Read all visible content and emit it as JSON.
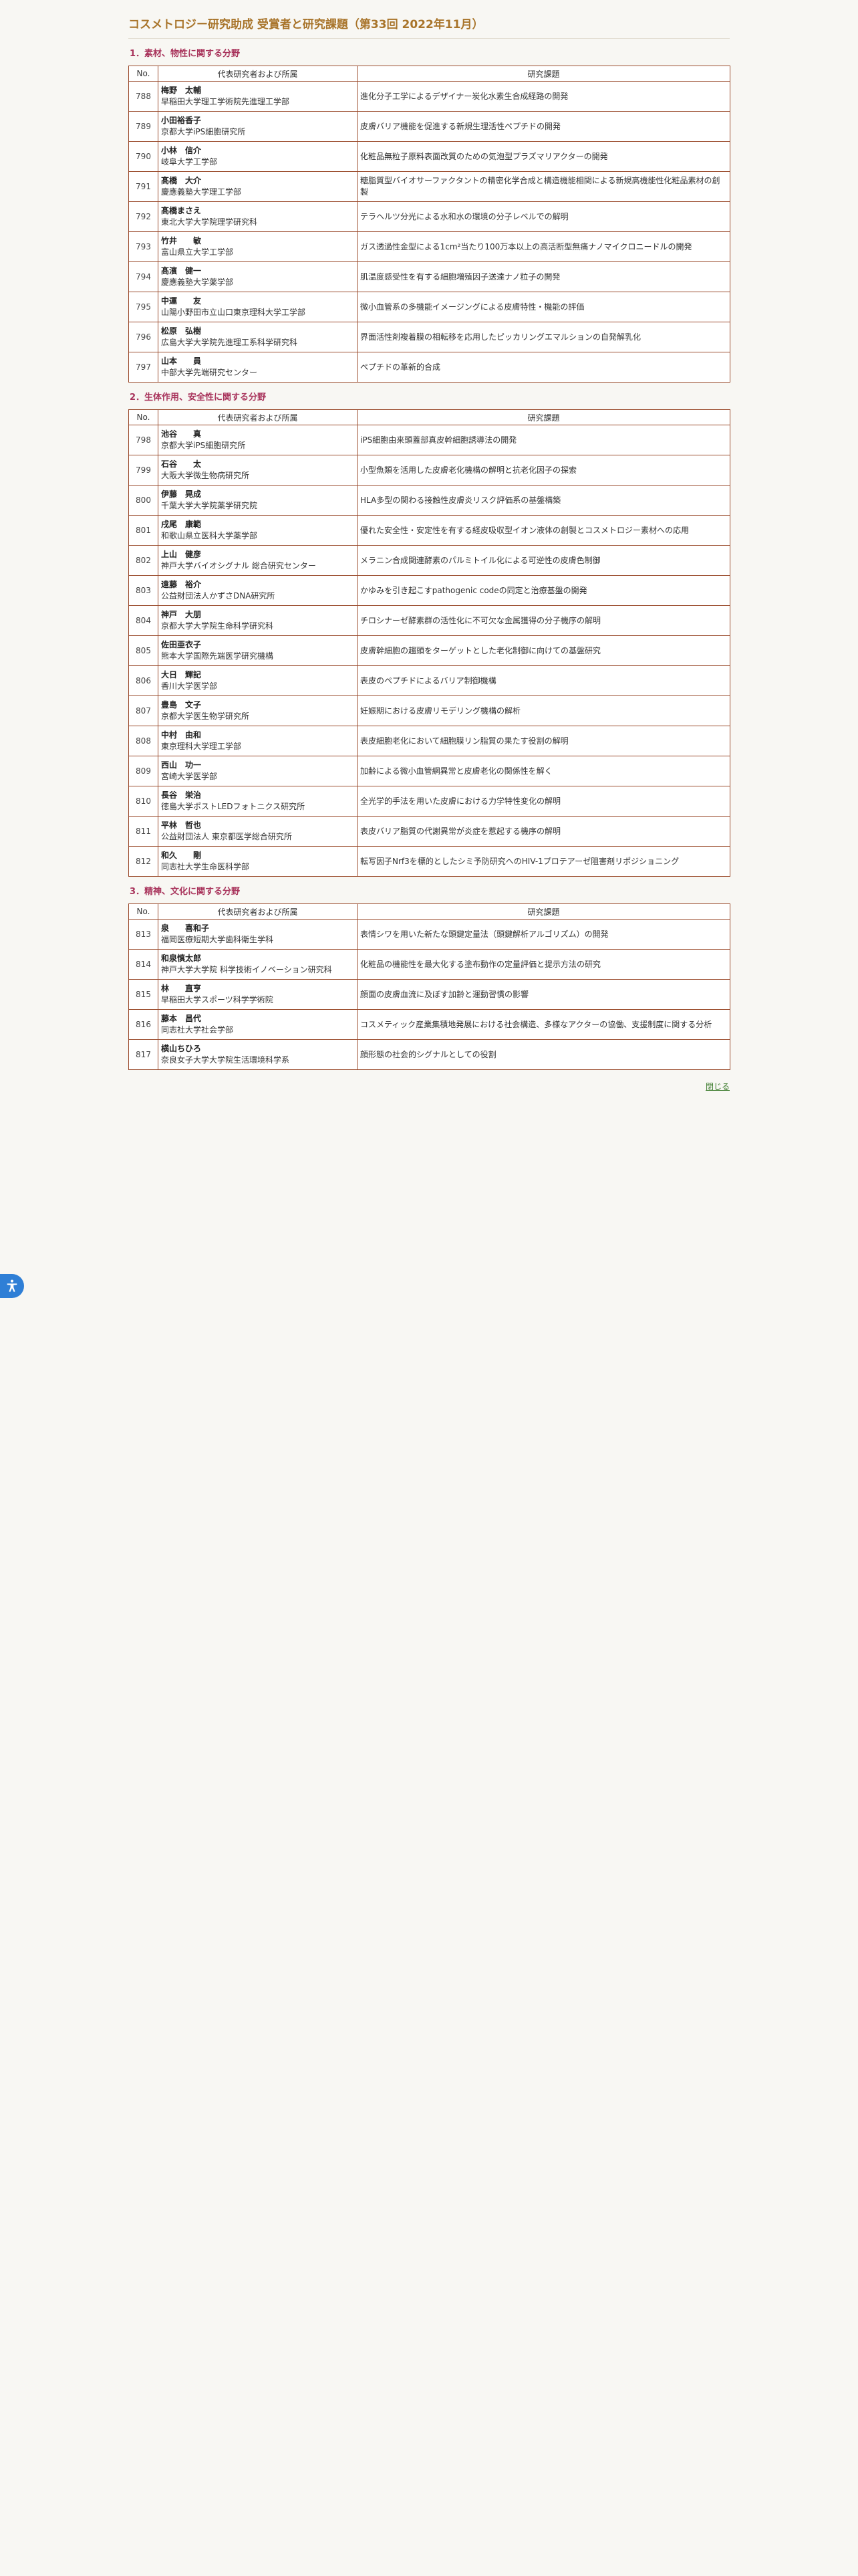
{
  "page_title": "コスメトロジー研究助成 受賞者と研究課題（第33回 2022年11月）",
  "table_headers": {
    "no": "No.",
    "person": "代表研究者および所属",
    "topic": "研究課題"
  },
  "close_label": "閉じる",
  "sections": [
    {
      "title": "1．素材、物性に関する分野",
      "rows": [
        {
          "no": "788",
          "name": "梅野　太輔",
          "aff": "早稲田大学理工学術院先進理工学部",
          "topic": "進化分子工学によるデザイナー炭化水素生合成経路の開発"
        },
        {
          "no": "789",
          "name": "小田裕香子",
          "aff": "京都大学iPS細胞研究所",
          "topic": "皮膚バリア機能を促進する新規生理活性ペプチドの開発"
        },
        {
          "no": "790",
          "name": "小林　信介",
          "aff": "岐阜大学工学部",
          "topic": "化粧品無粒子原料表面改質のための気泡型プラズマリアクターの開発"
        },
        {
          "no": "791",
          "name": "髙橋　大介",
          "aff": "慶應義塾大学理工学部",
          "topic": "糖脂質型バイオサーファクタントの精密化学合成と構造機能相関による新規高機能性化粧品素材の創製"
        },
        {
          "no": "792",
          "name": "髙橋まさえ",
          "aff": "東北大学大学院理学研究科",
          "topic": "テラヘルツ分光による水和水の環境の分子レベルでの解明"
        },
        {
          "no": "793",
          "name": "竹井　　敏",
          "aff": "富山県立大学工学部",
          "topic": "ガス透過性金型による1cm²当たり100万本以上の高活断型無痛ナノマイクロニードルの開発"
        },
        {
          "no": "794",
          "name": "髙濱　健一",
          "aff": "慶應義塾大学薬学部",
          "topic": "肌温度感受性を有する細胞増殖因子送達ナノ粒子の開発"
        },
        {
          "no": "795",
          "name": "中運　　友",
          "aff": "山陽小野田市立山口東京理科大学工学部",
          "topic": "微小血管系の多機能イメージングによる皮膚特性・機能の評価"
        },
        {
          "no": "796",
          "name": "松原　弘樹",
          "aff": "広島大学大学院先進理工系科学研究科",
          "topic": "界面活性剤複着膜の相転移を応用したピッカリングエマルションの自発解乳化"
        },
        {
          "no": "797",
          "name": "山本　　員",
          "aff": "中部大学先端研究センター",
          "topic": "ペプチドの革新的合成"
        }
      ]
    },
    {
      "title": "2．生体作用、安全性に関する分野",
      "rows": [
        {
          "no": "798",
          "name": "池谷　　真",
          "aff": "京都大学iPS細胞研究所",
          "topic": "iPS細胞由来頭蓋部真皮幹細胞誘導法の開発"
        },
        {
          "no": "799",
          "name": "石谷　　太",
          "aff": "大阪大学微生物病研究所",
          "topic": "小型魚類を活用した皮膚老化機構の解明と抗老化因子の探索"
        },
        {
          "no": "800",
          "name": "伊藤　晃成",
          "aff": "千葉大学大学院薬学研究院",
          "topic": "HLA多型の関わる接触性皮膚炎リスク評価系の基盤構築"
        },
        {
          "no": "801",
          "name": "戌尾　康範",
          "aff": "和歌山県立医科大学薬学部",
          "topic": "優れた安全性・安定性を有する経皮吸収型イオン液体の創製とコスメトロジー素材への応用"
        },
        {
          "no": "802",
          "name": "上山　健彦",
          "aff": "神戸大学バイオシグナル 総合研究センター",
          "topic": "メラニン合成関連酵素のパルミトイル化による可逆性の皮膚色制御"
        },
        {
          "no": "803",
          "name": "遠藤　裕介",
          "aff": "公益財団法人かずさDNA研究所",
          "topic": "かゆみを引き起こすpathogenic codeの同定と治療基盤の開発"
        },
        {
          "no": "804",
          "name": "神戸　大朋",
          "aff": "京都大学大学院生命科学研究科",
          "topic": "チロシナーゼ酵素群の活性化に不可欠な金属獲得の分子機序の解明"
        },
        {
          "no": "805",
          "name": "佐田亜衣子",
          "aff": "熊本大学国際先端医学研究機構",
          "topic": "皮膚幹細胞の趨頭をターゲットとした老化制御に向けての基盤研究"
        },
        {
          "no": "806",
          "name": "大日　輝記",
          "aff": "香川大学医学部",
          "topic": "表皮のペプチドによるバリア制御機構"
        },
        {
          "no": "807",
          "name": "豊島　文子",
          "aff": "京都大学医生物学研究所",
          "topic": "妊娠期における皮膚リモデリング機構の解析"
        },
        {
          "no": "808",
          "name": "中村　由和",
          "aff": "東京理科大学理工学部",
          "topic": "表皮細胞老化において細胞膜リン脂質の果たす役割の解明"
        },
        {
          "no": "809",
          "name": "西山　功一",
          "aff": "宮崎大学医学部",
          "topic": "加齢による微小血管網異常と皮膚老化の関係性を解く"
        },
        {
          "no": "810",
          "name": "長谷　栄治",
          "aff": "徳島大学ポストLEDフォトニクス研究所",
          "topic": "全光学的手法を用いた皮膚における力学特性変化の解明"
        },
        {
          "no": "811",
          "name": "平林　哲也",
          "aff": "公益財団法人 東京都医学総合研究所",
          "topic": "表皮バリア脂質の代謝異常が炎症を惹起する機序の解明"
        },
        {
          "no": "812",
          "name": "和久　　剛",
          "aff": "同志社大学生命医科学部",
          "topic": "転写因子Nrf3を標的としたシミ予防研究へのHIV-1プロテアーゼ阻害剤リポジショニング"
        }
      ]
    },
    {
      "title": "3．精神、文化に関する分野",
      "rows": [
        {
          "no": "813",
          "name": "泉　　喜和子",
          "aff": "福岡医療短期大学歯科衛生学科",
          "topic": "表情シワを用いた新たな頭鍵定量法（頭鍵解析アルゴリズム）の開発"
        },
        {
          "no": "814",
          "name": "和泉慎太郎",
          "aff": "神戸大学大学院 科学技術イノベーション研究科",
          "topic": "化粧品の機能性を最大化する塗布動作の定量評価と提示方法の研究"
        },
        {
          "no": "815",
          "name": "林　　直亨",
          "aff": "早稲田大学スポーツ科学学術院",
          "topic": "顔面の皮膚血流に及ぼす加齢と運動習慣の影響"
        },
        {
          "no": "816",
          "name": "藤本　昌代",
          "aff": "同志社大学社会学部",
          "topic": "コスメティック産業集積地発展における社会構造、多様なアクターの協働、支援制度に関する分析"
        },
        {
          "no": "817",
          "name": "横山ちひろ",
          "aff": "奈良女子大学大学院生活環境科学系",
          "topic": "顔形態の社会的シグナルとしての役割"
        }
      ]
    }
  ]
}
